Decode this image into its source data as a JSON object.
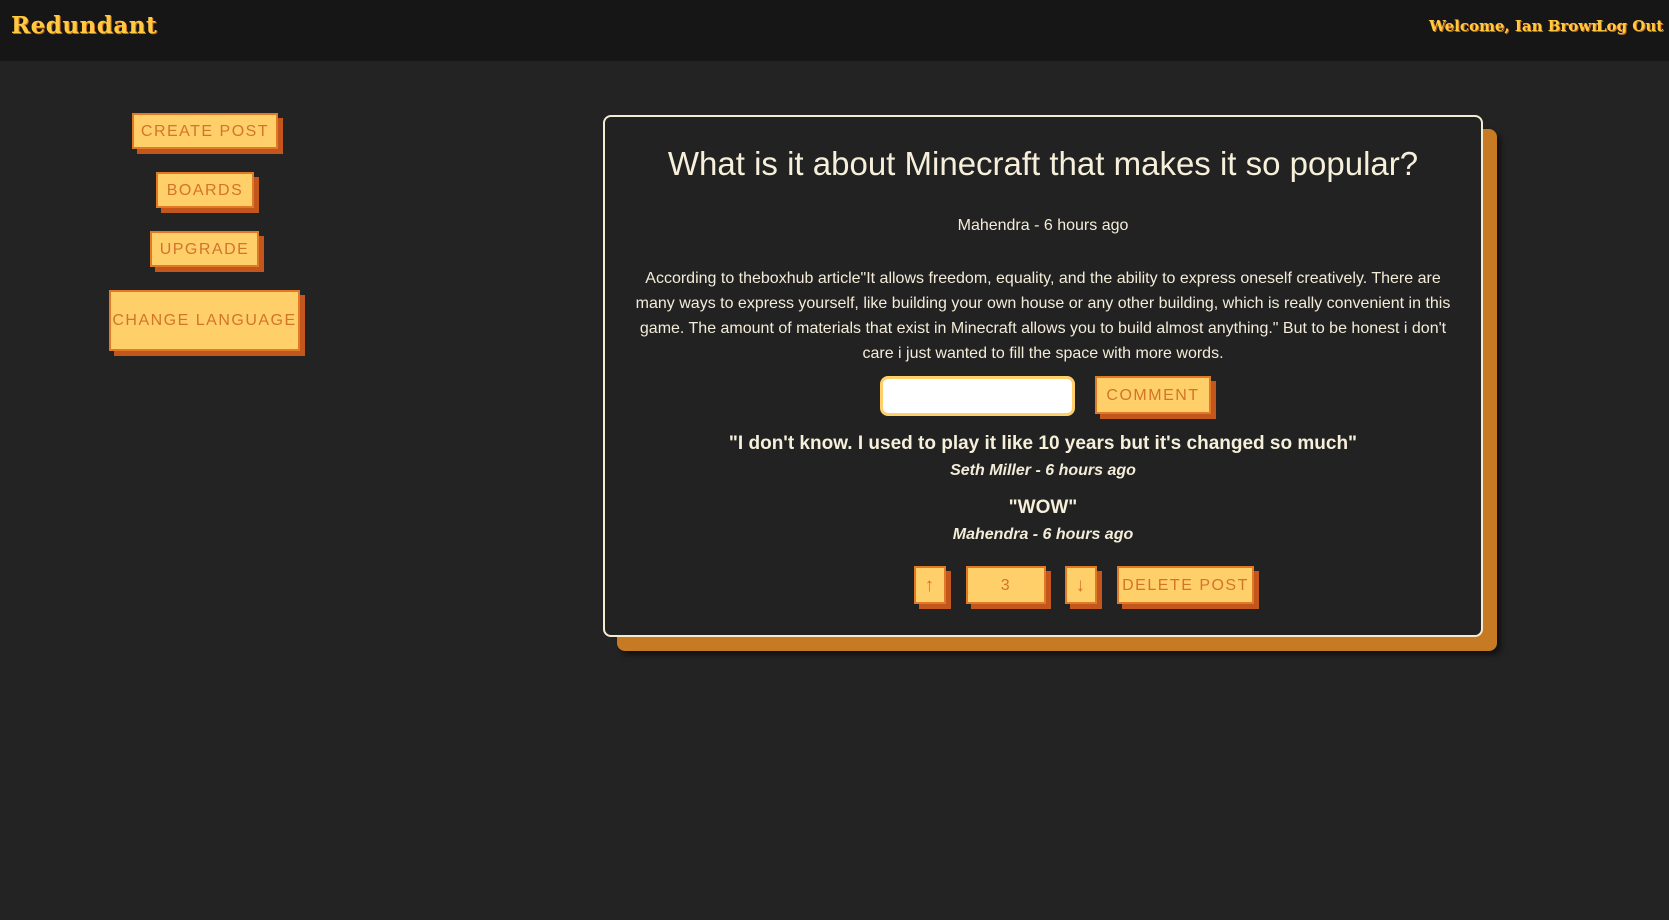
{
  "header": {
    "brand": "Redundant",
    "welcome": "Welcome, Ian Brown",
    "logout_label": "Log Out"
  },
  "sidebar": {
    "items": [
      {
        "label": "CREATE POST"
      },
      {
        "label": "BOARDS"
      },
      {
        "label": "UPGRADE"
      },
      {
        "label": "CHANGE LANGUAGE"
      }
    ]
  },
  "post": {
    "title": "What is it about Minecraft that makes it so popular?",
    "meta": "Mahendra - 6 hours ago",
    "body": "According to theboxhub article\"It allows freedom, equality, and the ability to express oneself creatively. There are many ways to express yourself, like building your own house or any other building, which is really convenient in this game. The amount of materials that exist in Minecraft allows you to build almost anything.\" But to be honest i don't care i just wanted to fill the space with more words.",
    "comment_input": {
      "value": "",
      "placeholder": ""
    },
    "comment_button": "COMMENT",
    "comments": [
      {
        "text": "\"I don't know. I used to play it like 10 years but it's changed so much\"",
        "meta": "Seth Miller - 6 hours ago"
      },
      {
        "text": "\"WOW\"",
        "meta": "Mahendra - 6 hours ago"
      }
    ],
    "vote": {
      "up_label": "↑",
      "count": "3",
      "down_label": "↓"
    },
    "delete_button": "DELETE POST"
  },
  "colors": {
    "background": "#232323",
    "topbar": "#161616",
    "accent": "#ffc940",
    "button_fill": "#ffcf6a",
    "button_text": "#d4742a",
    "button_shadow": "#c3561d",
    "card_border": "#f4ecd2"
  }
}
